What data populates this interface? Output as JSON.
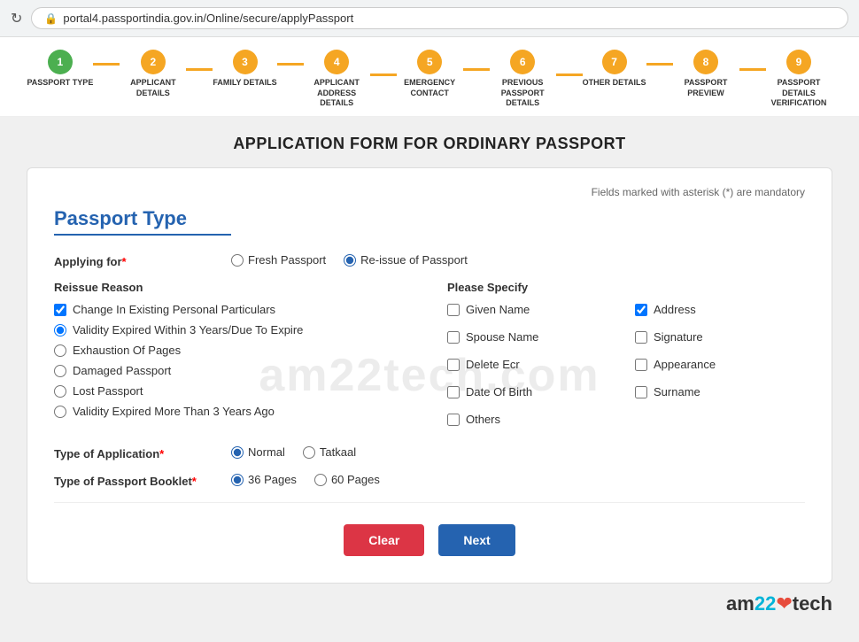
{
  "browser": {
    "url": "portal4.passportindia.gov.in/Online/secure/applyPassport",
    "lock_icon": "🔒"
  },
  "steps": [
    {
      "num": "1",
      "label": "PASSPORT TYPE",
      "state": "completed"
    },
    {
      "num": "2",
      "label": "APPLICANT DETAILS",
      "state": "active"
    },
    {
      "num": "3",
      "label": "FAMILY DETAILS",
      "state": "active"
    },
    {
      "num": "4",
      "label": "APPLICANT ADDRESS DETAILS",
      "state": "active"
    },
    {
      "num": "5",
      "label": "EMERGENCY CONTACT",
      "state": "active"
    },
    {
      "num": "6",
      "label": "PREVIOUS PASSPORT DETAILS",
      "state": "active"
    },
    {
      "num": "7",
      "label": "OTHER DETAILS",
      "state": "active"
    },
    {
      "num": "8",
      "label": "PASSPORT PREVIEW",
      "state": "active"
    },
    {
      "num": "9",
      "label": "PASSPORT DETAILS VERIFICATION",
      "state": "active"
    }
  ],
  "page_title": "APPLICATION FORM FOR ORDINARY PASSPORT",
  "mandatory_note": "Fields marked with asterisk (*) are mandatory",
  "section_title": "Passport Type",
  "watermark_text": "am22tech.com",
  "applying_for": {
    "label": "Applying for",
    "required": true,
    "options": [
      {
        "value": "fresh",
        "label": "Fresh Passport"
      },
      {
        "value": "reissue",
        "label": "Re-issue of Passport",
        "selected": true
      }
    ]
  },
  "reissue_reason": {
    "heading": "Reissue Reason",
    "options": [
      {
        "value": "change_personal",
        "label": "Change In Existing Personal Particulars",
        "checked": true,
        "type": "checkbox"
      },
      {
        "value": "validity_3",
        "label": "Validity Expired Within 3 Years/Due To Expire",
        "checked": true,
        "type": "radio",
        "selected": true
      },
      {
        "value": "exhaustion",
        "label": "Exhaustion Of Pages",
        "checked": false,
        "type": "radio"
      },
      {
        "value": "damaged",
        "label": "Damaged Passport",
        "checked": false,
        "type": "radio"
      },
      {
        "value": "lost",
        "label": "Lost Passport",
        "checked": false,
        "type": "radio"
      },
      {
        "value": "validity_more",
        "label": "Validity Expired More Than 3 Years Ago",
        "checked": false,
        "type": "radio"
      }
    ]
  },
  "please_specify": {
    "heading": "Please Specify",
    "options": [
      {
        "label": "Given Name",
        "checked": false
      },
      {
        "label": "Address",
        "checked": true
      },
      {
        "label": "Spouse Name",
        "checked": false
      },
      {
        "label": "Signature",
        "checked": false
      },
      {
        "label": "Delete Ecr",
        "checked": false
      },
      {
        "label": "Appearance",
        "checked": false
      },
      {
        "label": "Date Of Birth",
        "checked": false
      },
      {
        "label": "Surname",
        "checked": false
      },
      {
        "label": "Others",
        "checked": false
      }
    ]
  },
  "type_of_application": {
    "label": "Type of Application",
    "required": true,
    "options": [
      {
        "value": "normal",
        "label": "Normal",
        "selected": true
      },
      {
        "value": "tatkaal",
        "label": "Tatkaal",
        "selected": false
      }
    ]
  },
  "type_of_booklet": {
    "label": "Type of Passport Booklet",
    "required": true,
    "options": [
      {
        "value": "36",
        "label": "36 Pages",
        "selected": true
      },
      {
        "value": "60",
        "label": "60 Pages",
        "selected": false
      }
    ]
  },
  "buttons": {
    "clear": "Clear",
    "next": "Next"
  },
  "brand": {
    "text": "am22",
    "heart": "❤",
    "tech": "tech"
  }
}
